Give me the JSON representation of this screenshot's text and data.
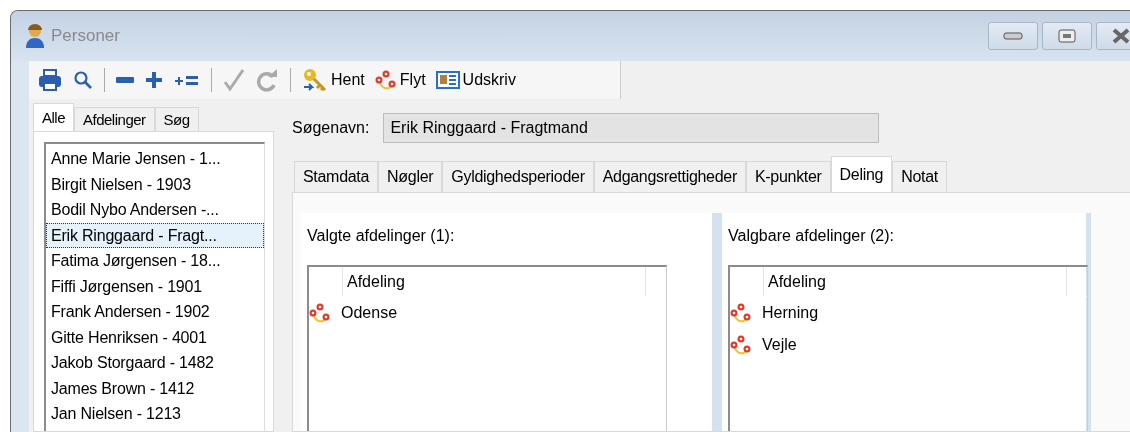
{
  "window": {
    "title": "Personer"
  },
  "toolbar": [
    {
      "kind": "print",
      "disabled": false
    },
    {
      "kind": "search",
      "disabled": false
    },
    {
      "kind": "separator"
    },
    {
      "kind": "minus",
      "disabled": false
    },
    {
      "kind": "plus",
      "disabled": false
    },
    {
      "kind": "plus-equals",
      "disabled": false
    },
    {
      "kind": "separator"
    },
    {
      "kind": "check",
      "disabled": true
    },
    {
      "kind": "redo",
      "disabled": true
    },
    {
      "kind": "separator"
    },
    {
      "kind": "key",
      "label": "Hent",
      "disabled": false
    },
    {
      "kind": "route",
      "label": "Flyt",
      "disabled": false
    },
    {
      "kind": "card",
      "label": "Udskriv",
      "disabled": false
    }
  ],
  "left_tabs": [
    {
      "label": "Alle",
      "selected": true
    },
    {
      "label": "Afdelinger",
      "selected": false
    },
    {
      "label": "Søg",
      "selected": false
    }
  ],
  "persons": [
    {
      "name": "Anne Marie Jensen - 1...",
      "selected": false
    },
    {
      "name": "Birgit Nielsen - 1903",
      "selected": false
    },
    {
      "name": "Bodil Nybo Andersen -...",
      "selected": false
    },
    {
      "name": "Erik Ringgaard - Fragt...",
      "selected": true
    },
    {
      "name": "Fatima Jørgensen - 18...",
      "selected": false
    },
    {
      "name": "Fiffi Jørgensen - 1901",
      "selected": false
    },
    {
      "name": "Frank Andersen - 1902",
      "selected": false
    },
    {
      "name": "Gitte Henriksen - 4001",
      "selected": false
    },
    {
      "name": "Jakob Storgaard - 1482",
      "selected": false
    },
    {
      "name": "James Brown - 1412",
      "selected": false
    },
    {
      "name": "Jan Nielsen - 1213",
      "selected": false
    }
  ],
  "search_name": {
    "label": "Søgenavn:",
    "value": "Erik Ringgaard - Fragtmand"
  },
  "tabs": [
    {
      "label": "Stamdata",
      "selected": false
    },
    {
      "label": "Nøgler",
      "selected": false
    },
    {
      "label": "Gyldighedsperioder",
      "selected": false
    },
    {
      "label": "Adgangsrettigheder",
      "selected": false
    },
    {
      "label": "K-punkter",
      "selected": false
    },
    {
      "label": "Deling",
      "selected": true
    },
    {
      "label": "Notat",
      "selected": false
    }
  ],
  "panels": [
    {
      "title": "Valgte afdelinger (1):",
      "column": "Afdeling",
      "rows": [
        "Odense"
      ]
    },
    {
      "title": "Valgbare afdelinger (2):",
      "column": "Afdeling",
      "rows": [
        "Herning",
        "Vejle"
      ]
    }
  ]
}
